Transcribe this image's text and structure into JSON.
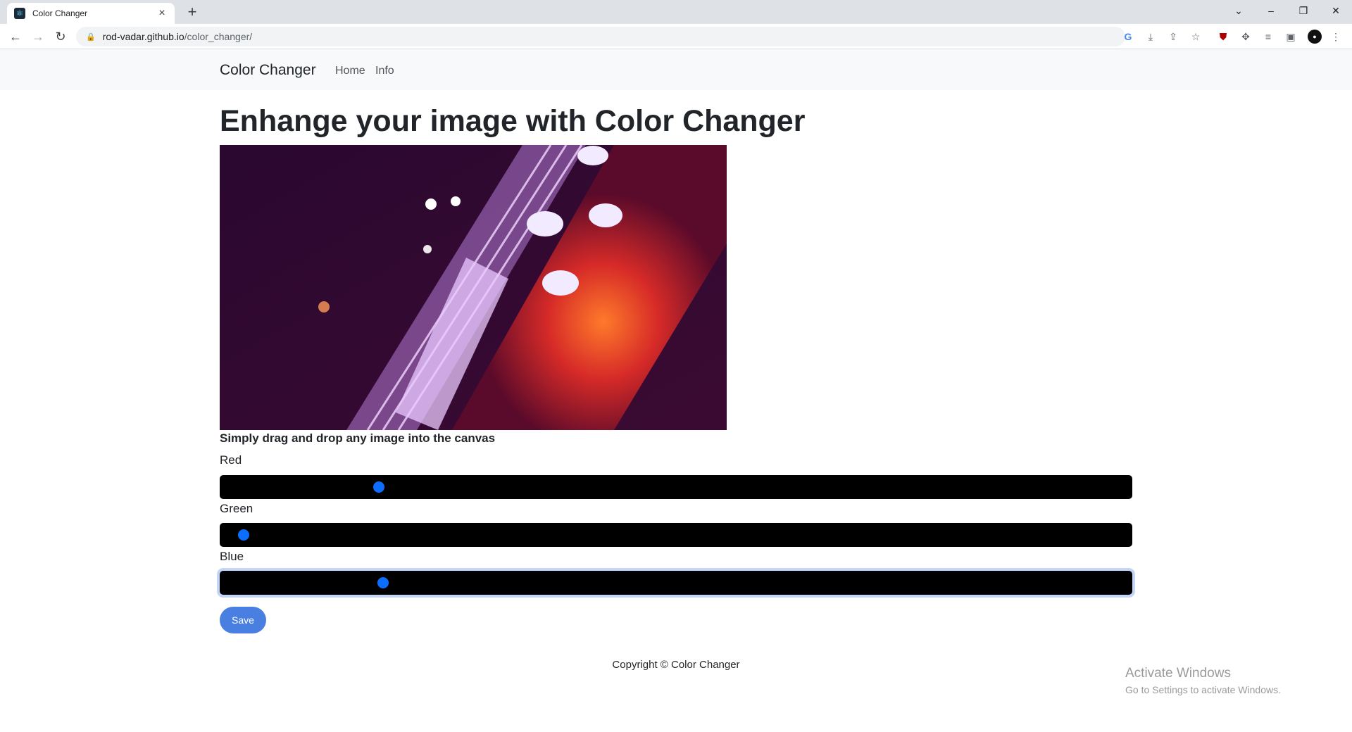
{
  "browser": {
    "tab_title": "Color Changer",
    "url_host": "rod-vadar.github.io",
    "url_path": "/color_changer/"
  },
  "nav": {
    "brand": "Color Changer",
    "links": [
      "Home",
      "Info"
    ]
  },
  "main": {
    "title": "Enhange your image with Color Changer",
    "hint": "Simply drag and drop any image into the canvas",
    "sliders": [
      {
        "label": "Red",
        "value_fraction": 0.17
      },
      {
        "label": "Green",
        "value_fraction": 0.02
      },
      {
        "label": "Blue",
        "value_fraction": 0.175
      }
    ],
    "save_label": "Save"
  },
  "footer": {
    "copyright": "Copyright © Color Changer"
  },
  "watermark": {
    "title": "Activate Windows",
    "subtitle": "Go to Settings to activate Windows."
  },
  "colors": {
    "slider_track": "#000000",
    "slider_thumb": "#0d6efd",
    "save_button": "#4a7fe2",
    "navbar_bg": "#f8f9fa"
  }
}
